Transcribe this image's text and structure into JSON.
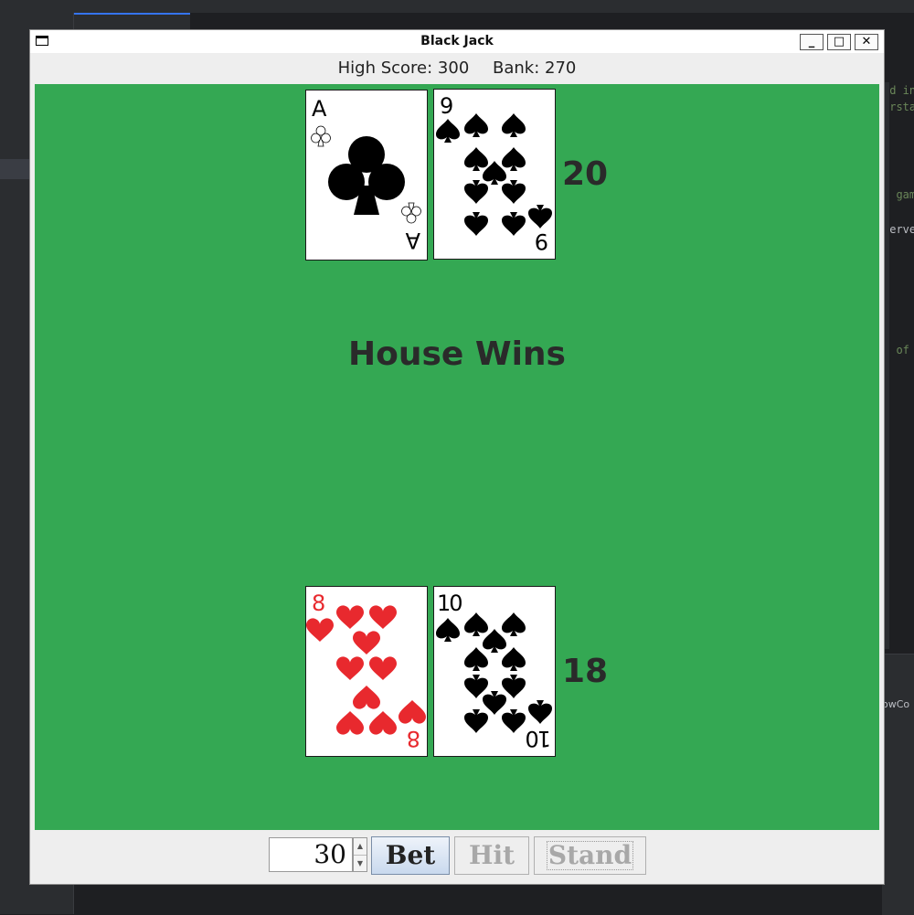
{
  "window": {
    "title": "Black Jack"
  },
  "status": {
    "high_score": "High Score: 300",
    "bank": "Bank: 270"
  },
  "dealer": {
    "cards": [
      {
        "rank": "A",
        "suit": "clubs",
        "color": "#000000"
      },
      {
        "rank": "9",
        "suit": "spades",
        "color": "#000000"
      }
    ],
    "total": "20"
  },
  "result": "House Wins",
  "player": {
    "cards": [
      {
        "rank": "8",
        "suit": "hearts",
        "color": "#e8292e"
      },
      {
        "rank": "10",
        "suit": "spades",
        "color": "#000000"
      }
    ],
    "total": "18"
  },
  "controls": {
    "bet_value": "30",
    "bet_label": "Bet",
    "hit_label": "Hit",
    "stand_label": "Stand"
  },
  "colors": {
    "table": "#34a853",
    "text": "#2a2a2a",
    "red_suit": "#e8292e"
  }
}
